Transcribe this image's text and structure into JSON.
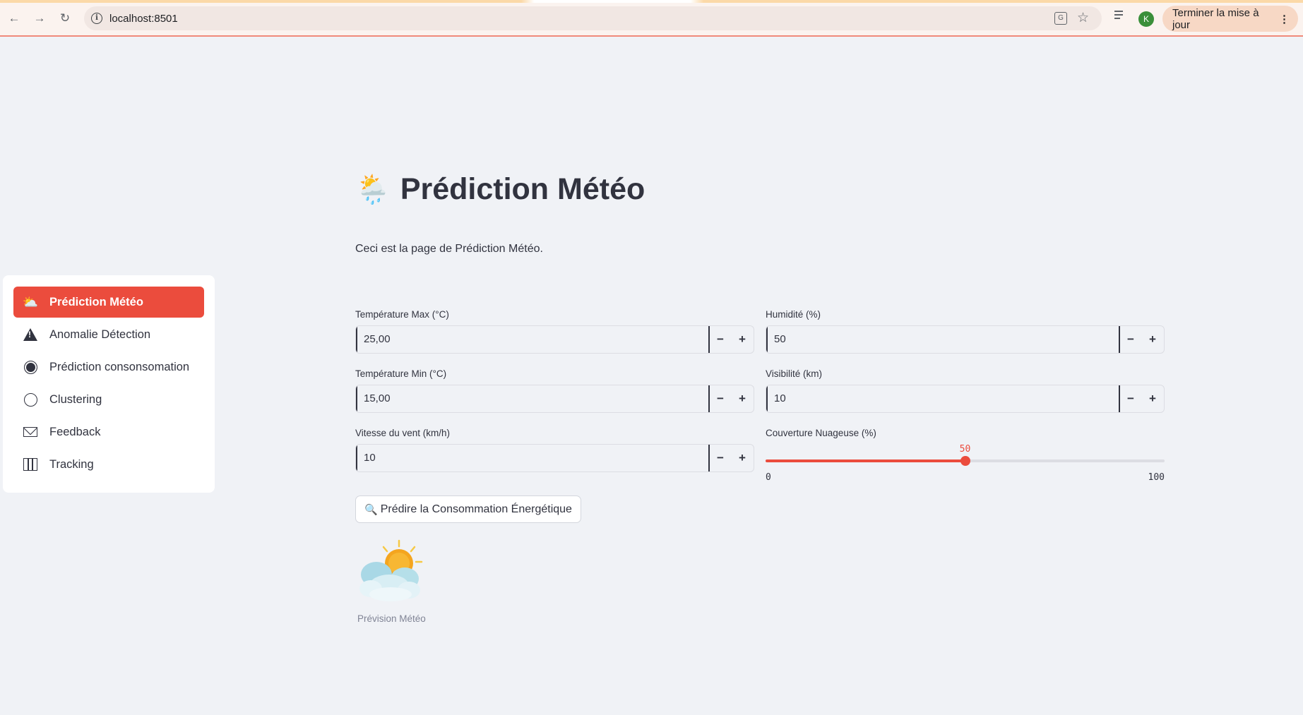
{
  "browser": {
    "url": "localhost:8501",
    "profile_initial": "K",
    "update_button_label": "Terminer la mise à jour",
    "icons": [
      "back-icon",
      "forward-icon",
      "reload-icon",
      "info-icon",
      "translate-icon",
      "star-icon",
      "media-queue-icon",
      "menu-dots-icon"
    ]
  },
  "sidebar": {
    "items": [
      {
        "label": "Prédiction Météo",
        "icon": "weather-icon",
        "active": true
      },
      {
        "label": "Anomalie Détection",
        "icon": "warning-icon",
        "active": false
      },
      {
        "label": "Prédiction consonsomation",
        "icon": "filled-circle-icon",
        "active": false
      },
      {
        "label": "Clustering",
        "icon": "circle-icon",
        "active": false
      },
      {
        "label": "Feedback",
        "icon": "envelope-icon",
        "active": false
      },
      {
        "label": "Tracking",
        "icon": "map-icon",
        "active": false
      }
    ]
  },
  "main": {
    "title_emoji": "🌦️",
    "title": "Prédiction Météo",
    "subtitle": "Ceci est la page de Prédiction Météo.",
    "fields": {
      "temp_max": {
        "label": "Température Max (°C)",
        "value": "25,00"
      },
      "humidity": {
        "label": "Humidité (%)",
        "value": "50"
      },
      "temp_min": {
        "label": "Température Min (°C)",
        "value": "15,00"
      },
      "visibility": {
        "label": "Visibilité (km)",
        "value": "10"
      },
      "wind_speed": {
        "label": "Vitesse du vent (km/h)",
        "value": "10"
      }
    },
    "stepper": {
      "minus": "−",
      "plus": "+"
    },
    "cloud_cover": {
      "label": "Couverture Nuageuse (%)",
      "value": "50",
      "min": "0",
      "max": "100",
      "fraction": 0.5
    },
    "predict_button": {
      "icon": "🔍",
      "label": "Prédire la Consommation Énergétique"
    },
    "image_caption": "Prévision Météo",
    "accent_color": "#eb4c3d"
  }
}
